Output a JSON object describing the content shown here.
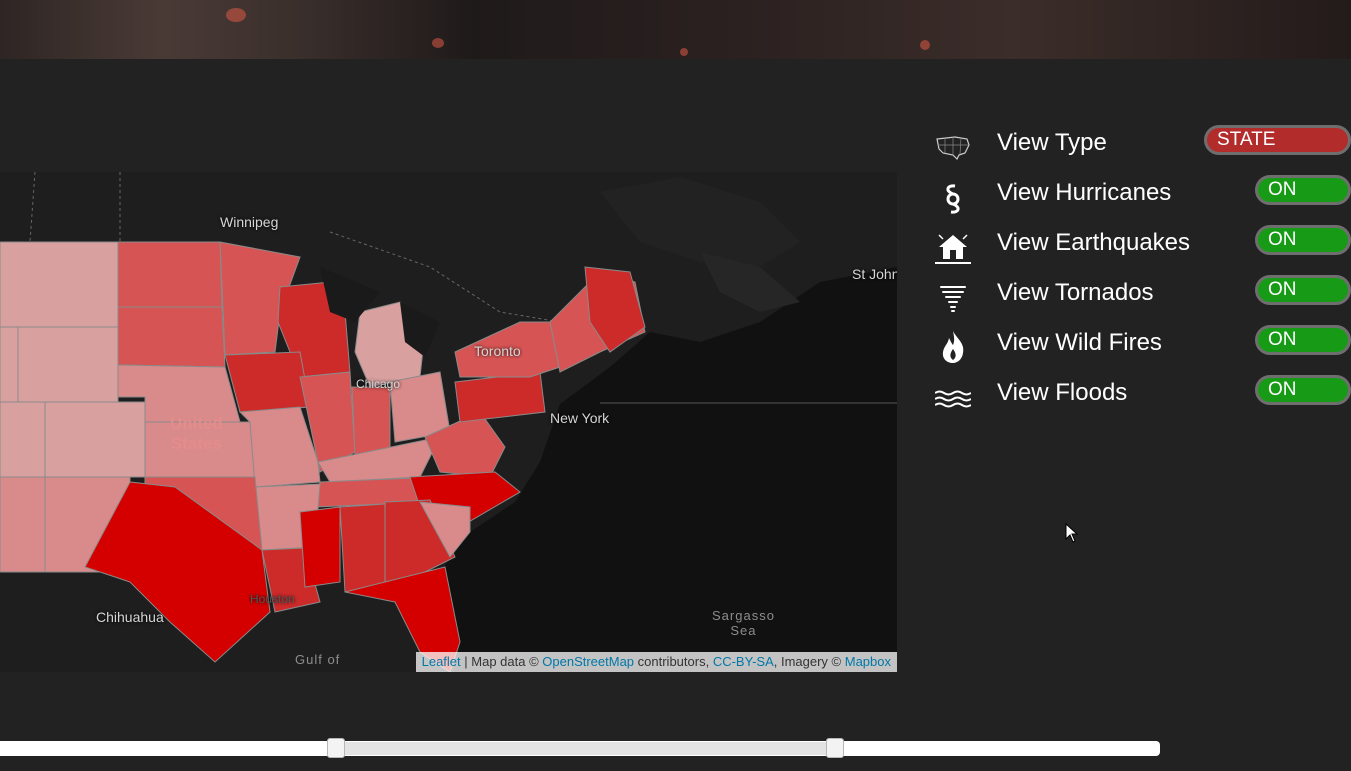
{
  "map": {
    "cities": {
      "winnipeg": "Winnipeg",
      "toronto": "Toronto",
      "chicago": "Chicago",
      "new_york": "New York",
      "st_johns": "St John",
      "chihuahua": "Chihuahua",
      "houston": "Houston"
    },
    "country_label_line1": "United",
    "country_label_line2": "States",
    "sargasso_line1": "Sargasso",
    "sargasso_line2": "Sea",
    "gulf_label": "Gulf of",
    "attribution": {
      "leaflet": "Leaflet",
      "sep": " | Map data © ",
      "osm": "OpenStreetMap",
      "contributors": " contributors, ",
      "license": "CC-BY-SA",
      "imagery": ", Imagery © ",
      "mapbox": "Mapbox"
    }
  },
  "controls": [
    {
      "label": "View Type",
      "value": "STATE",
      "icon": "us-map-icon"
    },
    {
      "label": "View Hurricanes",
      "value": "ON",
      "icon": "hurricane-icon"
    },
    {
      "label": "View Earthquakes",
      "value": "ON",
      "icon": "earthquake-icon"
    },
    {
      "label": "View Tornados",
      "value": "ON",
      "icon": "tornado-icon"
    },
    {
      "label": "View Wild Fires",
      "value": "ON",
      "icon": "fire-icon"
    },
    {
      "label": "View Floods",
      "value": "ON",
      "icon": "flood-icon"
    }
  ],
  "date_slider": {
    "range_start_fraction": 0.29,
    "range_end_fraction": 0.72
  },
  "colors": {
    "page_bg": "#222222",
    "map_bg": "#111111",
    "toggle_on": "#179b17",
    "toggle_state": "#b32c2c",
    "choropleth_dark": "#d40000",
    "choropleth_light": "#d9a0a0"
  }
}
